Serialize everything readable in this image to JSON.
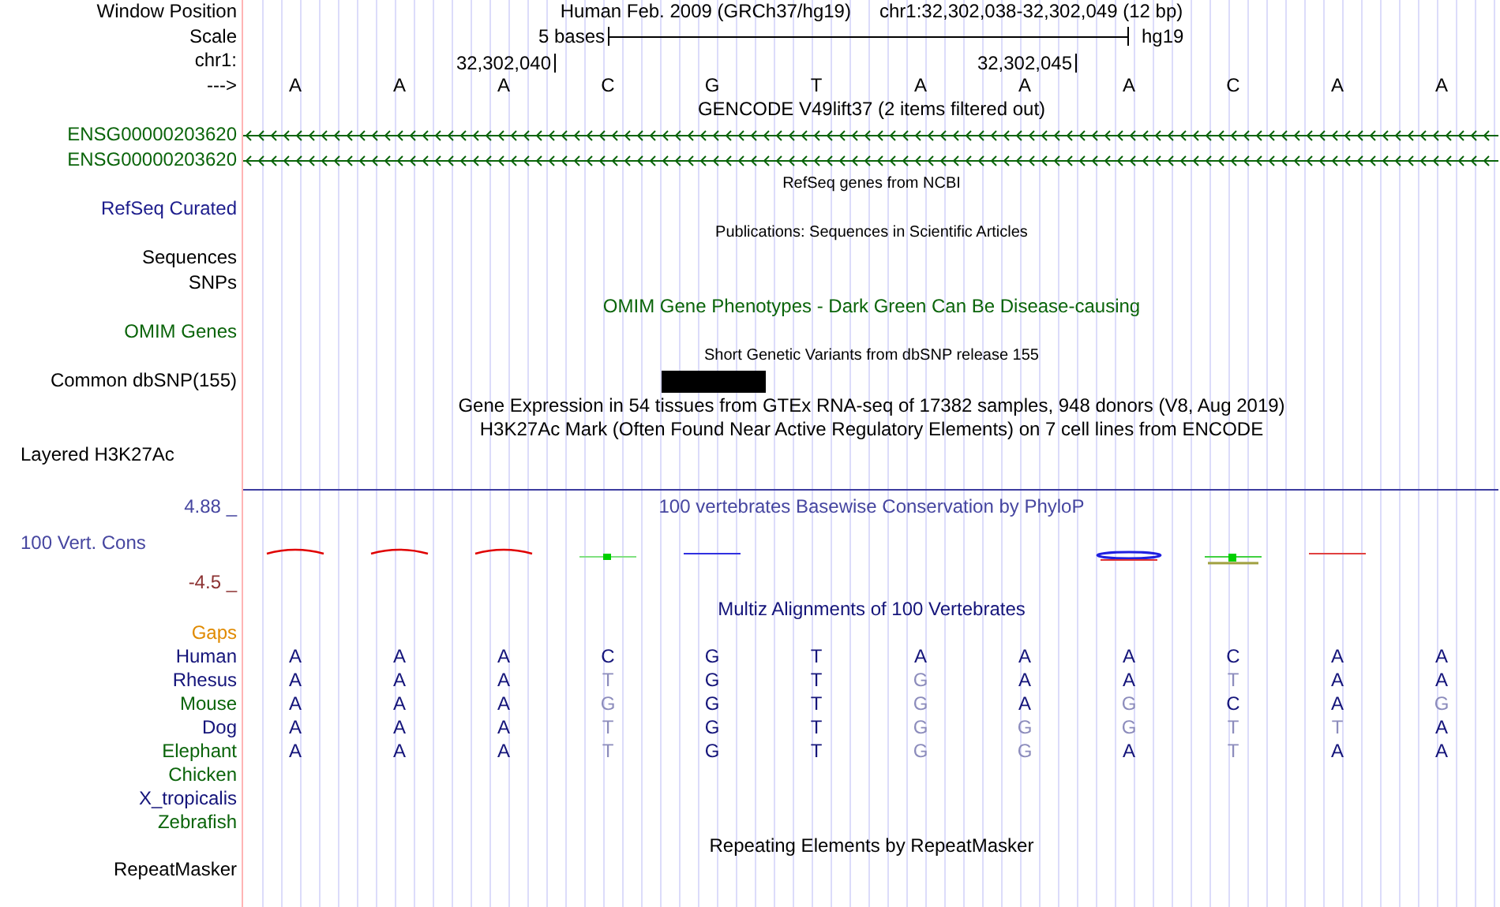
{
  "header": {
    "position_label": "Window Position",
    "assembly": "Human Feb. 2009 (GRCh37/hg19)",
    "range": "chr1:32,302,038-32,302,049 (12 bp)"
  },
  "scale": {
    "label": "Scale",
    "length": "5 bases",
    "assembly": "hg19"
  },
  "ruler": {
    "label": "chr1:",
    "ticks": [
      "32,302,040",
      "32,302,045"
    ]
  },
  "sequence": {
    "label": "--->",
    "bases": [
      "A",
      "A",
      "A",
      "C",
      "G",
      "T",
      "A",
      "A",
      "A",
      "C",
      "A",
      "A"
    ]
  },
  "tracks": [
    {
      "kind": "title",
      "text": "GENCODE V49lift37 (2 items filtered out)",
      "color": "#000000"
    },
    {
      "kind": "gene",
      "label": "ENSG00000203620",
      "color": "#0a640a"
    },
    {
      "kind": "gene",
      "label": "ENSG00000203620",
      "color": "#0a640a"
    },
    {
      "kind": "subtitle",
      "text": "RefSeq genes from NCBI",
      "color": "#000000"
    },
    {
      "kind": "label",
      "label": "RefSeq Curated",
      "color": "#1c1c8c"
    },
    {
      "kind": "subtitle",
      "text": "Publications: Sequences in Scientific Articles",
      "color": "#000000"
    },
    {
      "kind": "label",
      "label": "Sequences",
      "color": "#000000"
    },
    {
      "kind": "label",
      "label": "SNPs",
      "color": "#000000"
    },
    {
      "kind": "title",
      "text": "OMIM Gene Phenotypes - Dark Green Can Be Disease-causing",
      "color": "#0a640a"
    },
    {
      "kind": "label",
      "label": "OMIM Genes",
      "color": "#0a640a"
    },
    {
      "kind": "subtitle",
      "text": "Short Genetic Variants from dbSNP release 155",
      "color": "#000000"
    },
    {
      "kind": "variant",
      "label": "Common dbSNP(155)",
      "color": "#000000"
    },
    {
      "kind": "title",
      "text": "Gene Expression in 54 tissues from GTEx RNA-seq of 17382 samples, 948 donors (V8, Aug 2019)",
      "color": "#000000"
    },
    {
      "kind": "title",
      "text": "H3K27Ac Mark (Often Found Near Active Regulatory Elements) on 7 cell lines from ENCODE",
      "color": "#000000"
    },
    {
      "kind": "layered",
      "label": "Layered H3K27Ac",
      "color": "#000000"
    }
  ],
  "conservation": {
    "title": "100 vertebrates Basewise Conservation by PhyloP",
    "label": "100 Vert. Cons",
    "max": "4.88 _",
    "min": "-4.5 _"
  },
  "multiz": {
    "title": "Multiz Alignments of 100 Vertebrates",
    "gaps": "Gaps",
    "species": [
      {
        "name": "Human",
        "color": "#14147a",
        "bases": [
          "A",
          "A",
          "A",
          "C",
          "G",
          "T",
          "A",
          "A",
          "A",
          "C",
          "A",
          "A"
        ],
        "conserved": [
          true,
          true,
          true,
          true,
          true,
          true,
          true,
          true,
          true,
          true,
          true,
          true
        ]
      },
      {
        "name": "Rhesus",
        "color": "#14147a",
        "bases": [
          "A",
          "A",
          "A",
          "T",
          "G",
          "T",
          "G",
          "A",
          "A",
          "T",
          "A",
          "A"
        ],
        "conserved": [
          true,
          true,
          true,
          false,
          true,
          true,
          false,
          true,
          true,
          false,
          true,
          true
        ]
      },
      {
        "name": "Mouse",
        "color": "#0a640a",
        "bases": [
          "A",
          "A",
          "A",
          "G",
          "G",
          "T",
          "G",
          "A",
          "G",
          "C",
          "A",
          "G"
        ],
        "conserved": [
          true,
          true,
          true,
          false,
          true,
          true,
          false,
          true,
          false,
          true,
          true,
          false
        ]
      },
      {
        "name": "Dog",
        "color": "#14147a",
        "bases": [
          "A",
          "A",
          "A",
          "T",
          "G",
          "T",
          "G",
          "G",
          "G",
          "T",
          "T",
          "A"
        ],
        "conserved": [
          true,
          true,
          true,
          false,
          true,
          true,
          false,
          false,
          false,
          false,
          false,
          true
        ]
      },
      {
        "name": "Elephant",
        "color": "#0a640a",
        "bases": [
          "A",
          "A",
          "A",
          "T",
          "G",
          "T",
          "G",
          "G",
          "A",
          "T",
          "A",
          "A"
        ],
        "conserved": [
          true,
          true,
          true,
          false,
          true,
          true,
          false,
          false,
          true,
          false,
          true,
          true
        ]
      },
      {
        "name": "Chicken",
        "color": "#0a640a"
      },
      {
        "name": "X_tropicalis",
        "color": "#14147a"
      },
      {
        "name": "Zebrafish",
        "color": "#0a640a"
      }
    ]
  },
  "repeats": {
    "title": "Repeating Elements by RepeatMasker",
    "label": "RepeatMasker"
  }
}
